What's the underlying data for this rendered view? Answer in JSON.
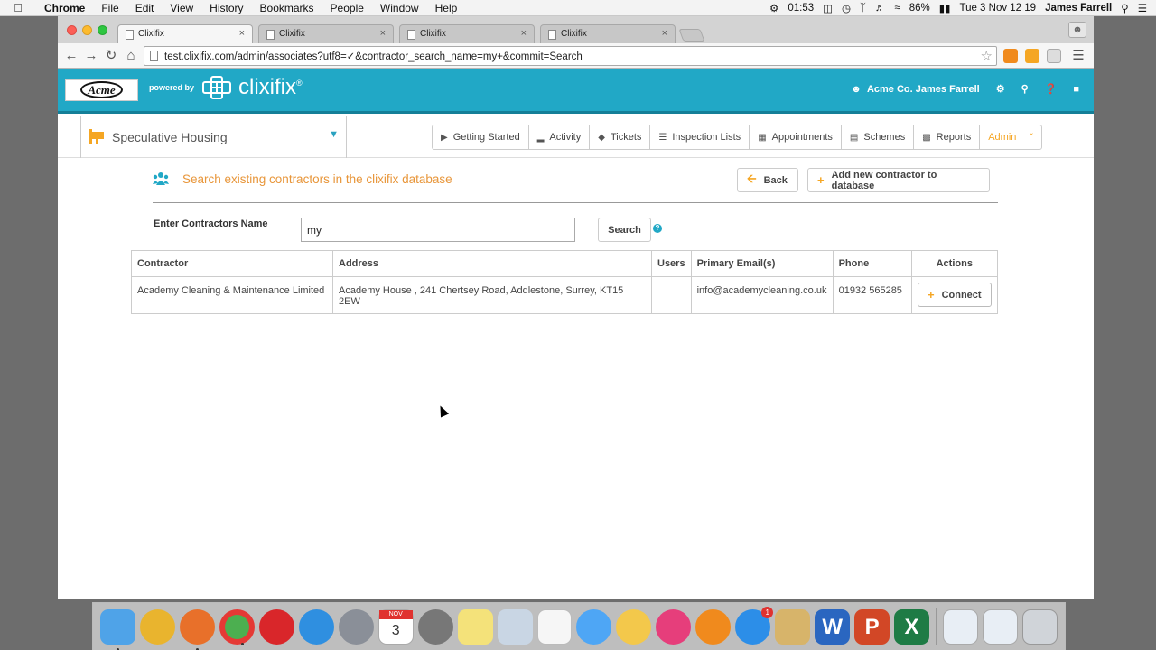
{
  "menubar": {
    "items": [
      "Chrome",
      "File",
      "Edit",
      "View",
      "History",
      "Bookmarks",
      "People",
      "Window",
      "Help"
    ],
    "time_small": "01:53",
    "battery": "86%",
    "datetime": "Tue 3 Nov  12 19",
    "user": "James Farrell"
  },
  "browser": {
    "tabs": [
      {
        "title": "Clixifix",
        "close": "×"
      },
      {
        "title": "Clixifix",
        "close": "×"
      },
      {
        "title": "Clixifix",
        "close": "×"
      },
      {
        "title": "Clixifix",
        "close": "×"
      }
    ],
    "url": "test.clixifix.com/admin/associates?utf8=✓&contractor_search_name=my+&commit=Search"
  },
  "header": {
    "logo_text": "Acme",
    "powered_by": "powered by",
    "brand": "clixifix",
    "brand_reg": "®",
    "user": "Acme Co. James Farrell"
  },
  "subnav": {
    "project": "Speculative Housing",
    "tabs": [
      "Getting Started",
      "Activity",
      "Tickets",
      "Inspection Lists",
      "Appointments",
      "Schemes",
      "Reports",
      "Admin"
    ]
  },
  "page": {
    "heading": "Search existing contractors in the clixifix database",
    "back_label": "Back",
    "add_label": "Add new contractor to database",
    "search_label": "Enter Contractors Name",
    "search_value": "my",
    "search_button": "Search",
    "help": "?"
  },
  "table": {
    "headers": [
      "Contractor",
      "Address",
      "Users",
      "Primary Email(s)",
      "Phone",
      "Actions"
    ],
    "rows": [
      {
        "contractor": "Academy Cleaning & Maintenance Limited",
        "address": "Academy House , 241 Chertsey Road, Addlestone, Surrey, KT15 2EW",
        "users": "",
        "email": "info@academycleaning.co.uk",
        "phone": "01932 565285",
        "action": "Connect"
      }
    ]
  },
  "dock": {
    "calendar_month": "NOV",
    "calendar_day": "3",
    "appstore_badge": "1"
  },
  "colors": {
    "header_blue": "#21a8c6",
    "accent_orange": "#e8963a"
  }
}
